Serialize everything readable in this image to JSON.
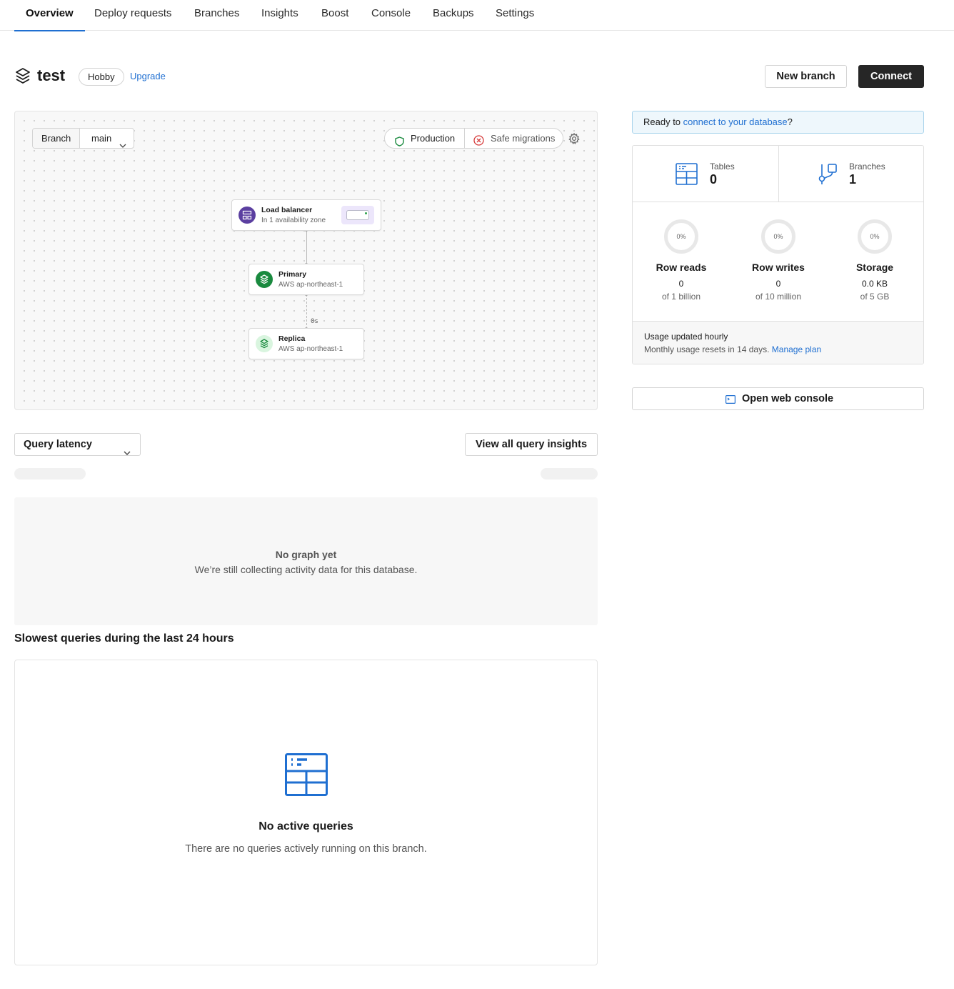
{
  "nav": {
    "tabs": [
      {
        "label": "Overview",
        "active": true
      },
      {
        "label": "Deploy requests"
      },
      {
        "label": "Branches"
      },
      {
        "label": "Insights"
      },
      {
        "label": "Boost"
      },
      {
        "label": "Console"
      },
      {
        "label": "Backups"
      },
      {
        "label": "Settings"
      }
    ]
  },
  "header": {
    "icon": "database-layers-icon",
    "db_name": "test",
    "plan_badge": "Hobby",
    "upgrade_link": "Upgrade",
    "new_branch_label": "New branch",
    "connect_label": "Connect"
  },
  "diagram": {
    "branch_label": "Branch",
    "branch_value": "main",
    "production_label": "Production",
    "safe_migrations_label": "Safe migrations",
    "load_balancer": {
      "title": "Load balancer",
      "subtitle": "In 1 availability zone"
    },
    "primary": {
      "title": "Primary",
      "subtitle": "AWS ap-northeast-1"
    },
    "replica": {
      "title": "Replica",
      "subtitle": "AWS ap-northeast-1",
      "lag": "0s"
    }
  },
  "sidebar": {
    "ready_prefix": "Ready to ",
    "ready_link": "connect to your database",
    "ready_suffix": "?",
    "tables": {
      "label": "Tables",
      "value": "0"
    },
    "branches": {
      "label": "Branches",
      "value": "1"
    },
    "usage": [
      {
        "name": "Row reads",
        "percent": "0%",
        "value": "0",
        "limit": "of 1 billion"
      },
      {
        "name": "Row writes",
        "percent": "0%",
        "value": "0",
        "limit": "of 10 million"
      },
      {
        "name": "Storage",
        "percent": "0%",
        "value": "0.0 KB",
        "limit": "of 5 GB"
      }
    ],
    "usage_updated": "Usage updated hourly",
    "usage_reset": "Monthly usage resets in 14 days.",
    "manage_plan": "Manage plan",
    "web_console_label": "Open web console"
  },
  "latency": {
    "select_value": "Query latency",
    "view_all_label": "View all query insights",
    "empty_title": "No graph yet",
    "empty_desc": "We’re still collecting activity data for this database."
  },
  "slowest": {
    "heading": "Slowest queries during the last 24 hours",
    "empty_title": "No active queries",
    "empty_desc": "There are no queries actively running on this branch."
  },
  "colors": {
    "accent": "#1f6fd1",
    "primary_node": "#1a8a3f",
    "replica_node": "#d9f5df",
    "load_balancer": "#5b3fa0",
    "dark_button": "#262626"
  }
}
